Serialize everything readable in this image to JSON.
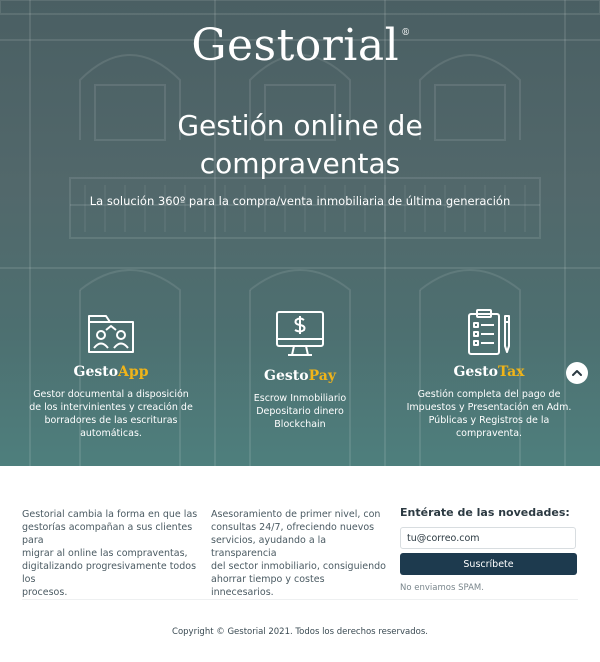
{
  "brand": {
    "name": "Gestorial",
    "mark": "®"
  },
  "hero": {
    "headline_line1": "Gestión online de",
    "headline_line2": "compraventas",
    "subline": "La solución 360º para la compra/venta inmobiliaria de última generación"
  },
  "features": [
    {
      "icon": "folder-people-icon",
      "name_prefix": "Gesto",
      "name_accent": "App",
      "desc": [
        "Gestor documental a disposición",
        "de los intervinientes y creación de",
        "borradores de las escrituras",
        "automáticas."
      ]
    },
    {
      "icon": "monitor-dollar-icon",
      "name_prefix": "Gesto",
      "name_accent": "Pay",
      "desc": [
        "Escrow Inmobiliario",
        "Depositario dinero",
        "Blockchain"
      ]
    },
    {
      "icon": "clipboard-pen-icon",
      "name_prefix": "Gesto",
      "name_accent": "Tax",
      "desc": [
        "Gestión completa del pago de",
        "Impuestos y Presentación en Adm.",
        "Públicas y Registros de la",
        "compraventa."
      ]
    }
  ],
  "scroll_up": {
    "icon": "chevron-up-icon"
  },
  "footer": {
    "col1": [
      "Gestorial cambia la forma en que las",
      "gestorías acompañan a sus clientes para",
      "migrar al online las compraventas,",
      "digitalizando progresivamente todos los",
      "procesos."
    ],
    "col2": [
      "Asesoramiento de primer nivel, con",
      "consultas 24/7, ofreciendo nuevos",
      "servicios, ayudando a la transparencia",
      "del sector inmobiliario, consiguiendo",
      "ahorrar tiempo y costes innecesarios."
    ],
    "newsletter": {
      "title": "Entérate de las novedades:",
      "email_value": "tu@correo.com",
      "button_label": "Suscríbete",
      "note": "No enviamos SPAM."
    },
    "copyright": "Copyright © Gestorial 2021. Todos los derechos reservados."
  },
  "colors": {
    "accent": "#f0b419",
    "button": "#1d3a4e",
    "hero_tint": "#4e7f7d"
  }
}
